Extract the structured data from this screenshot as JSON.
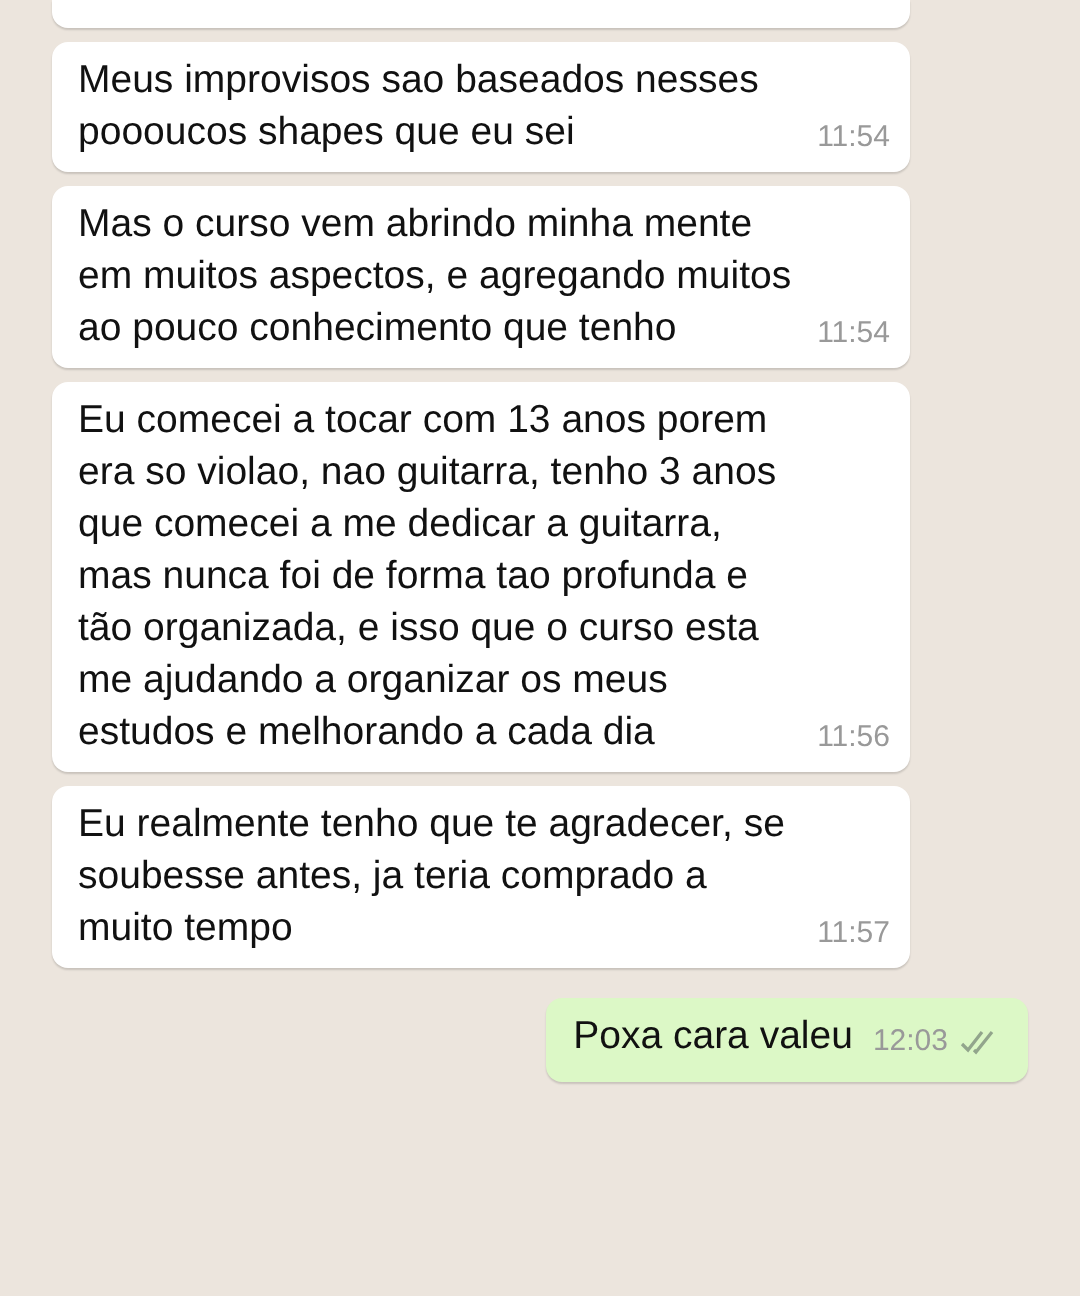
{
  "messages": [
    {
      "outgoing": false,
      "text": "Meus improvisos sao baseados nesses poooucos shapes que eu sei",
      "time": "11:54"
    },
    {
      "outgoing": false,
      "text": "Mas o curso vem abrindo minha mente em muitos aspectos, e agregando muitos ao pouco conhecimento que tenho",
      "time": "11:54"
    },
    {
      "outgoing": false,
      "text": "Eu comecei a tocar com 13 anos porem era so violao, nao guitarra, tenho 3 anos que comecei a me dedicar a guitarra, mas nunca foi de forma tao profunda e tão organizada, e isso que o curso esta me ajudando a organizar os meus estudos e melhorando a cada dia",
      "time": "11:56"
    },
    {
      "outgoing": false,
      "text": "Eu realmente tenho que te agradecer, se soubesse antes, ja teria comprado a muito tempo",
      "time": "11:57"
    },
    {
      "outgoing": true,
      "text": "Poxa cara valeu",
      "time": "12:03",
      "read": false
    }
  ]
}
